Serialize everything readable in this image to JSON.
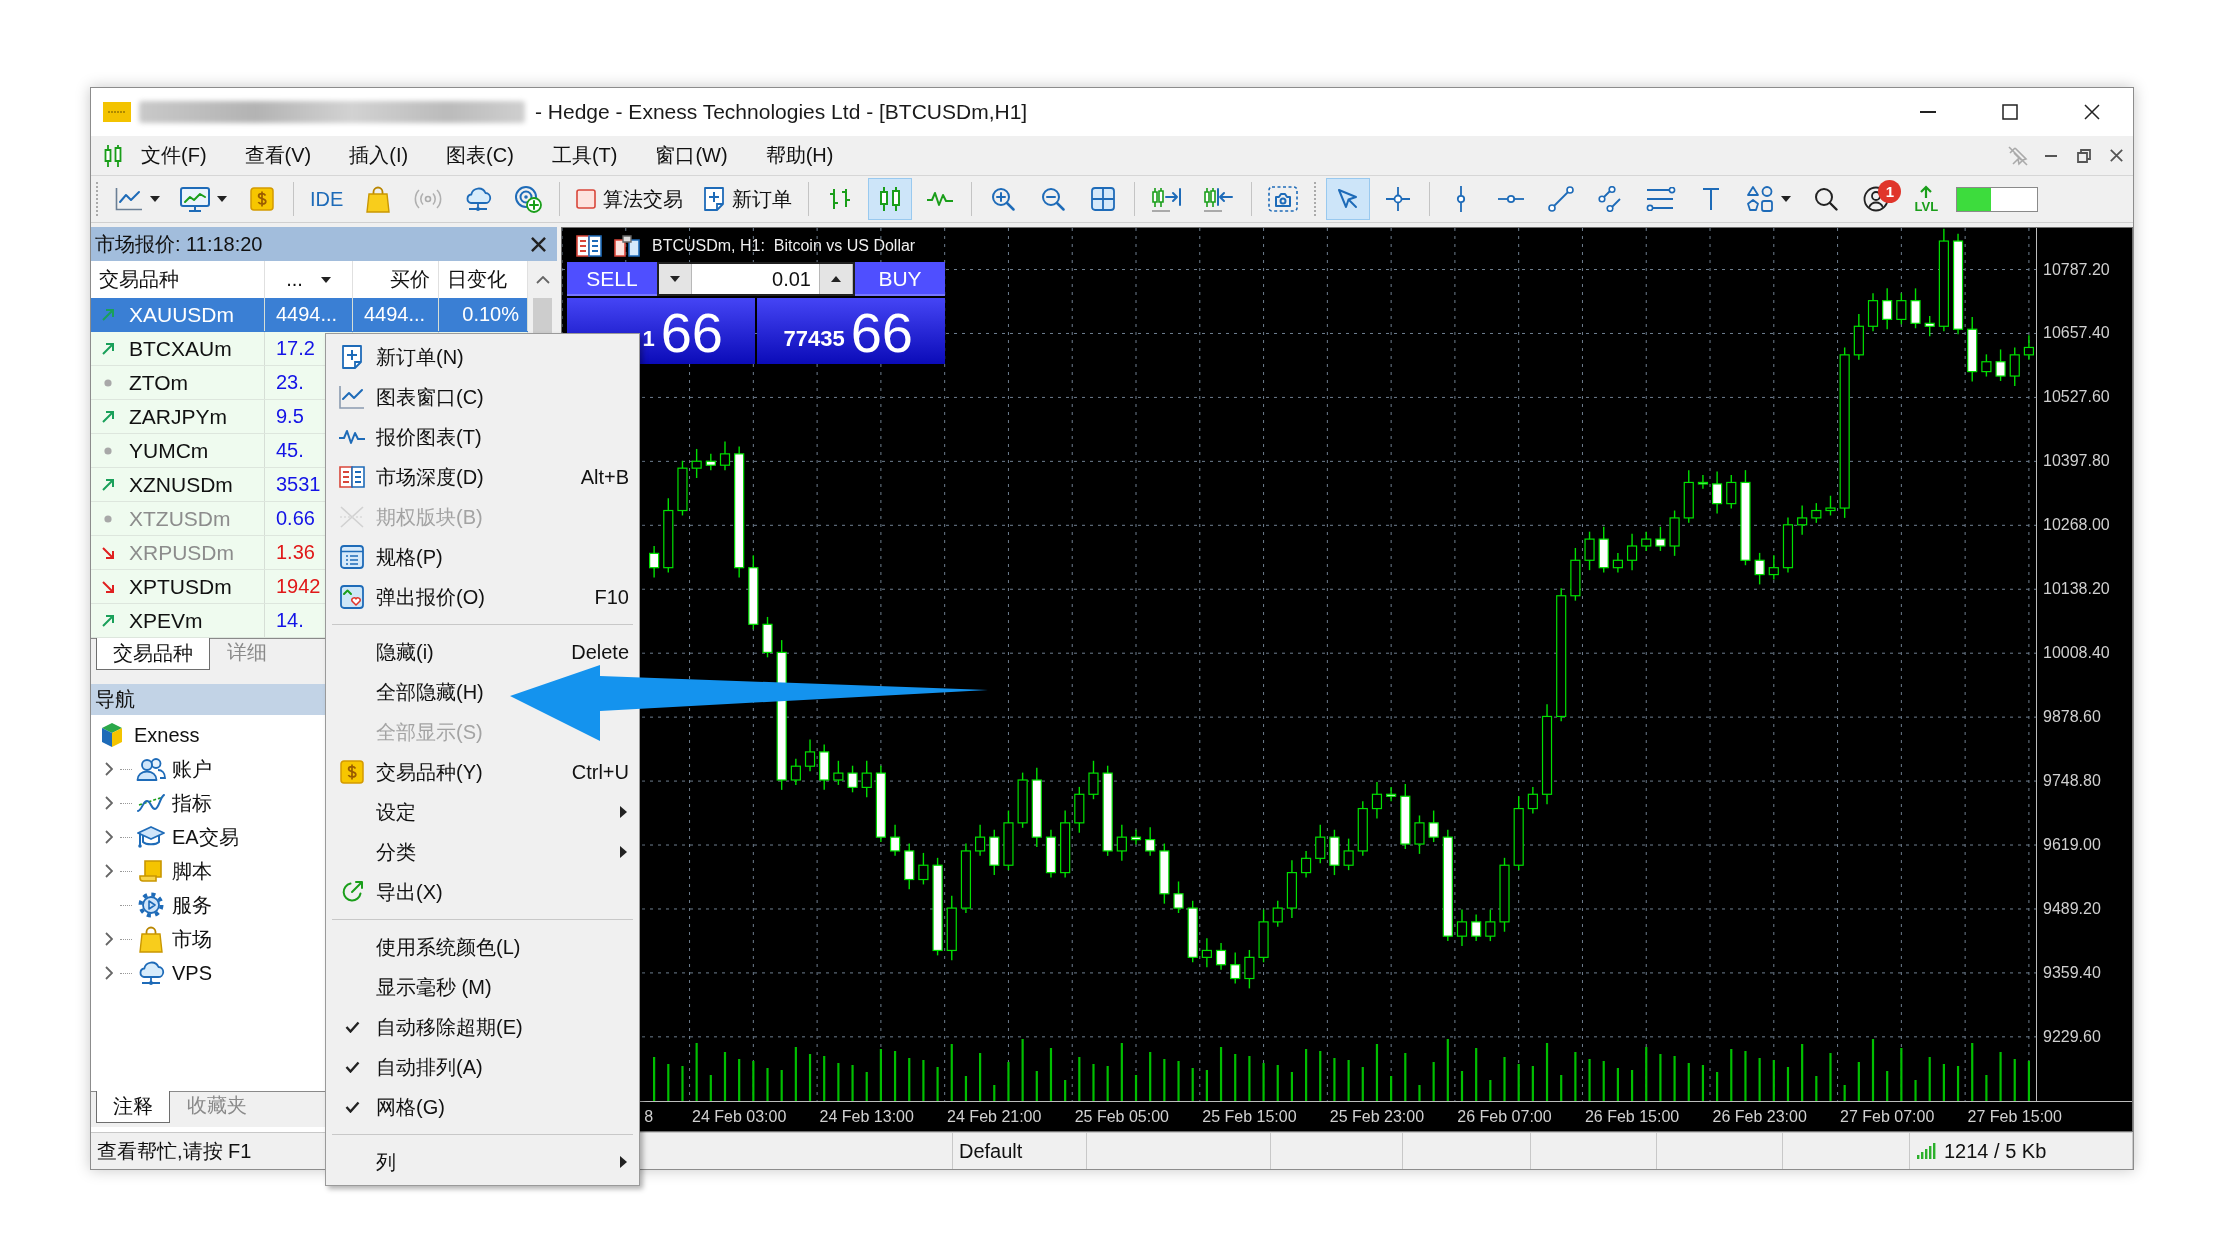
{
  "window": {
    "title": "- Hedge - Exness Technologies Ltd - [BTCUSDm,H1]"
  },
  "menu_bar": {
    "items": [
      "文件(F)",
      "查看(V)",
      "插入(I)",
      "图表(C)",
      "工具(T)",
      "窗口(W)",
      "帮助(H)"
    ]
  },
  "toolbar": {
    "ide_label": "IDE",
    "algo_trading_label": "算法交易",
    "new_order_label": "新订单",
    "chart_types": [
      {
        "selected": false
      },
      {
        "selected": true
      },
      {
        "selected": false
      }
    ],
    "cursor_modes": [
      {
        "selected": true
      },
      {
        "selected": false
      }
    ],
    "notification_badge": "1",
    "level_label": "LVL",
    "level_meter": {
      "level": 0.42
    }
  },
  "market_watch": {
    "title": "市场报价: 11:18:20",
    "columns": [
      "交易品种",
      "...",
      "买价",
      "日变化"
    ],
    "rows": [
      {
        "kind": "up",
        "dimmed": false,
        "selected": true,
        "cells": [
          "XAUUSDm",
          "4494...",
          "4494...",
          "0.10%"
        ]
      },
      {
        "kind": "up",
        "dimmed": false,
        "selected": false,
        "cells": [
          "BTCXAUm",
          "17.2"
        ]
      },
      {
        "kind": "none",
        "dimmed": false,
        "selected": false,
        "cells": [
          "ZTOm",
          "23."
        ]
      },
      {
        "kind": "up",
        "dimmed": false,
        "selected": false,
        "cells": [
          "ZARJPYm",
          "9.5"
        ]
      },
      {
        "kind": "none",
        "dimmed": false,
        "selected": false,
        "cells": [
          "YUMCm",
          "45."
        ]
      },
      {
        "kind": "up",
        "dimmed": false,
        "selected": false,
        "cells": [
          "XZNUSDm",
          "3531"
        ]
      },
      {
        "kind": "none",
        "dimmed": true,
        "selected": false,
        "cells": [
          "XTZUSDm",
          "0.66"
        ]
      },
      {
        "kind": "down",
        "dimmed": true,
        "selected": false,
        "cells": [
          "XRPUSDm",
          "1.36"
        ]
      },
      {
        "kind": "down",
        "dimmed": false,
        "selected": false,
        "cells": [
          "XPTUSDm",
          "1942"
        ]
      },
      {
        "kind": "up",
        "dimmed": false,
        "selected": false,
        "cells": [
          "XPEVm",
          "14."
        ]
      }
    ],
    "tabs": [
      {
        "label": "交易品种",
        "selected": true
      },
      {
        "label": "详细",
        "selected": false
      }
    ]
  },
  "navigator": {
    "title": "导航",
    "tree": [
      {
        "label": "Exness",
        "children": [
          {
            "label": "账户",
            "expanded": false
          },
          {
            "label": "指标",
            "expanded": false
          },
          {
            "label": "EA交易",
            "expanded": false
          },
          {
            "label": "脚本",
            "expanded": false
          },
          {
            "label": "服务"
          },
          {
            "label": "市场",
            "expanded": false
          },
          {
            "label": "VPS",
            "expanded": false
          }
        ]
      }
    ],
    "tabs": [
      {
        "label": "注释",
        "selected": true
      },
      {
        "label": "收藏夹",
        "selected": false
      }
    ]
  },
  "chart": {
    "title": "BTCUSDm, H1:  Bitcoin vs US Dollar",
    "trade_panel": {
      "sell_label": "SELL",
      "buy_label": "BUY",
      "volume": "0.01",
      "sell_price": {
        "prefix": "1",
        "main": "66"
      },
      "buy_price": {
        "prefix": "77435",
        "main": "66"
      }
    },
    "cut_time_label": "8",
    "chart_data": {
      "type": "candlestick",
      "grid": true,
      "categories": [
        null,
        null,
        null,
        null,
        null,
        null,
        null,
        null,
        null,
        null,
        null,
        null,
        "24 Feb 03:00",
        null,
        null,
        null,
        null,
        null,
        null,
        null,
        null,
        "24 Feb 13:00",
        null,
        null,
        null,
        null,
        null,
        null,
        null,
        null,
        "24 Feb 21:00",
        null,
        null,
        null,
        null,
        null,
        null,
        null,
        null,
        "25 Feb 05:00",
        null,
        null,
        null,
        null,
        null,
        null,
        null,
        null,
        "25 Feb 15:00",
        null,
        null,
        null,
        null,
        null,
        null,
        null,
        null,
        "25 Feb 23:00",
        null,
        null,
        null,
        null,
        null,
        null,
        null,
        null,
        "26 Feb 07:00",
        null,
        null,
        null,
        null,
        null,
        null,
        null,
        null,
        "26 Feb 15:00",
        null,
        null,
        null,
        null,
        null,
        null,
        null,
        null,
        "26 Feb 23:00",
        null,
        null,
        null,
        null,
        null,
        null,
        null,
        null,
        "27 Feb 07:00",
        null,
        null,
        null,
        null,
        null,
        null,
        null,
        null,
        "27 Feb 15:00",
        null
      ],
      "ohlc": [
        null,
        null,
        null,
        null,
        null,
        null,
        [
          10211,
          10226,
          10162,
          10182
        ],
        [
          10182,
          10323,
          10172,
          10298
        ],
        [
          10298,
          10399,
          10288,
          10384
        ],
        [
          10384,
          10423,
          10364,
          10398
        ],
        [
          10398,
          10413,
          10380,
          10390
        ],
        [
          10390,
          10438,
          10380,
          10413
        ],
        [
          10413,
          10428,
          10162,
          10182
        ],
        [
          10182,
          10207,
          10057,
          10067
        ],
        [
          10067,
          10082,
          10000,
          10010
        ],
        [
          10010,
          10035,
          9731,
          9751
        ],
        [
          9751,
          9794,
          9741,
          9779
        ],
        [
          9779,
          9833,
          9769,
          9808
        ],
        [
          9808,
          9823,
          9731,
          9751
        ],
        [
          9751,
          9790,
          9741,
          9765
        ],
        [
          9765,
          9780,
          9726,
          9736
        ],
        [
          9736,
          9790,
          9716,
          9765
        ],
        [
          9765,
          9780,
          9625,
          9635
        ],
        [
          9635,
          9660,
          9597,
          9607
        ],
        [
          9607,
          9622,
          9529,
          9549
        ],
        [
          9549,
          9603,
          9539,
          9578
        ],
        [
          9578,
          9593,
          9395,
          9405
        ],
        [
          9405,
          9516,
          9385,
          9491
        ],
        [
          9491,
          9622,
          9481,
          9607
        ],
        [
          9607,
          9660,
          9597,
          9635
        ],
        [
          9635,
          9650,
          9558,
          9578
        ],
        [
          9578,
          9689,
          9568,
          9664
        ],
        [
          9664,
          9766,
          9654,
          9751
        ],
        [
          9751,
          9776,
          9615,
          9635
        ],
        [
          9635,
          9650,
          9553,
          9563
        ],
        [
          9563,
          9689,
          9553,
          9664
        ],
        [
          9664,
          9737,
          9644,
          9722
        ],
        [
          9722,
          9790,
          9712,
          9765
        ],
        [
          9765,
          9780,
          9597,
          9607
        ],
        [
          9607,
          9660,
          9587,
          9635
        ],
        [
          9635,
          9650,
          9620,
          9630
        ],
        [
          9630,
          9655,
          9597,
          9607
        ],
        [
          9607,
          9622,
          9500,
          9520
        ],
        [
          9520,
          9545,
          9481,
          9491
        ],
        [
          9491,
          9506,
          9381,
          9391
        ],
        [
          9391,
          9430,
          9371,
          9405
        ],
        [
          9405,
          9420,
          9366,
          9376
        ],
        [
          9376,
          9401,
          9338,
          9348
        ],
        [
          9348,
          9406,
          9328,
          9391
        ],
        [
          9391,
          9488,
          9381,
          9463
        ],
        [
          9463,
          9506,
          9453,
          9491
        ],
        [
          9491,
          9588,
          9471,
          9563
        ],
        [
          9563,
          9607,
          9553,
          9592
        ],
        [
          9592,
          9660,
          9582,
          9635
        ],
        [
          9635,
          9650,
          9558,
          9578
        ],
        [
          9578,
          9632,
          9568,
          9607
        ],
        [
          9607,
          9708,
          9597,
          9693
        ],
        [
          9693,
          9747,
          9673,
          9722
        ],
        [
          9722,
          9737,
          9708,
          9718
        ],
        [
          9718,
          9743,
          9611,
          9621
        ],
        [
          9621,
          9679,
          9601,
          9664
        ],
        [
          9664,
          9689,
          9625,
          9635
        ],
        [
          9635,
          9650,
          9424,
          9434
        ],
        [
          9434,
          9488,
          9414,
          9463
        ],
        [
          9463,
          9478,
          9424,
          9434
        ],
        [
          9434,
          9488,
          9424,
          9463
        ],
        [
          9463,
          9593,
          9443,
          9578
        ],
        [
          9578,
          9718,
          9568,
          9693
        ],
        [
          9693,
          9737,
          9683,
          9722
        ],
        [
          9722,
          9905,
          9702,
          9880
        ],
        [
          9880,
          10140,
          9870,
          10125
        ],
        [
          10125,
          10222,
          10115,
          10197
        ],
        [
          10197,
          10255,
          10177,
          10240
        ],
        [
          10240,
          10265,
          10172,
          10182
        ],
        [
          10182,
          10212,
          10172,
          10197
        ],
        [
          10197,
          10251,
          10177,
          10226
        ],
        [
          10226,
          10255,
          10216,
          10240
        ],
        [
          10240,
          10265,
          10216,
          10226
        ],
        [
          10226,
          10298,
          10206,
          10283
        ],
        [
          10283,
          10380,
          10273,
          10355
        ],
        [
          10355,
          10370,
          10342,
          10352
        ],
        [
          10352,
          10377,
          10292,
          10312
        ],
        [
          10312,
          10370,
          10302,
          10355
        ],
        [
          10355,
          10380,
          10187,
          10197
        ],
        [
          10197,
          10212,
          10148,
          10168
        ],
        [
          10168,
          10207,
          10158,
          10182
        ],
        [
          10182,
          10284,
          10172,
          10269
        ],
        [
          10269,
          10308,
          10249,
          10283
        ],
        [
          10283,
          10313,
          10273,
          10298
        ],
        [
          10298,
          10328,
          10288,
          10303
        ],
        [
          10303,
          10629,
          10283,
          10614
        ],
        [
          10614,
          10697,
          10604,
          10672
        ],
        [
          10672,
          10739,
          10662,
          10724
        ],
        [
          10724,
          10749,
          10666,
          10686
        ],
        [
          10686,
          10739,
          10676,
          10724
        ],
        [
          10724,
          10749,
          10668,
          10678
        ],
        [
          10678,
          10693,
          10652,
          10672
        ],
        [
          10672,
          10870,
          10662,
          10845
        ],
        [
          10845,
          10860,
          10656,
          10666
        ],
        [
          10666,
          10691,
          10560,
          10580
        ],
        [
          10580,
          10615,
          10570,
          10600
        ],
        [
          10600,
          10625,
          10561,
          10571
        ],
        [
          10571,
          10629,
          10551,
          10614
        ],
        [
          10614,
          10654,
          10604,
          10629
        ]
      ],
      "ylim": [
        9099.4,
        10871.5
      ],
      "yticks": [
        {
          "value": 10787.2,
          "label": "10787.20"
        },
        {
          "value": 10657.4,
          "label": "10657.40"
        },
        {
          "value": 10527.6,
          "label": "10527.60"
        },
        {
          "value": 10397.8,
          "label": "10397.80"
        },
        {
          "value": 10268.0,
          "label": "10268.00"
        },
        {
          "value": 10138.2,
          "label": "10138.20"
        },
        {
          "value": 10008.4,
          "label": "10008.40"
        },
        {
          "value": 9878.6,
          "label": "9878.60"
        },
        {
          "value": 9748.8,
          "label": "9748.80"
        },
        {
          "value": 9619.0,
          "label": "9619.00"
        },
        {
          "value": 9489.2,
          "label": "9489.20"
        },
        {
          "value": 9359.4,
          "label": "9359.40"
        },
        {
          "value": 9229.6,
          "label": "9229.60"
        }
      ]
    }
  },
  "context_menu": {
    "items": [
      {
        "kind": "item",
        "label": "新订单(N)",
        "disabled": false,
        "checked": false,
        "submenu": false
      },
      {
        "kind": "item",
        "label": "图表窗口(C)",
        "disabled": false,
        "checked": false,
        "submenu": false
      },
      {
        "kind": "item",
        "label": "报价图表(T)",
        "disabled": false,
        "checked": false,
        "submenu": false
      },
      {
        "kind": "item",
        "label": "市场深度(D)",
        "shortcut": "Alt+B",
        "disabled": false,
        "checked": false,
        "submenu": false
      },
      {
        "kind": "item",
        "label": "期权版块(B)",
        "disabled": true,
        "checked": false,
        "submenu": false
      },
      {
        "kind": "item",
        "label": "规格(P)",
        "disabled": false,
        "checked": false,
        "submenu": false
      },
      {
        "kind": "item",
        "label": "弹出报价(O)",
        "shortcut": "F10",
        "disabled": false,
        "checked": false,
        "submenu": false
      },
      {
        "kind": "separator"
      },
      {
        "kind": "item",
        "label": "隐藏(i)",
        "shortcut": "Delete",
        "disabled": false,
        "checked": false,
        "submenu": false
      },
      {
        "kind": "item",
        "label": "全部隐藏(H)",
        "disabled": false,
        "checked": false,
        "submenu": false
      },
      {
        "kind": "item",
        "label": "全部显示(S)",
        "disabled": true,
        "checked": false,
        "submenu": false
      },
      {
        "kind": "item",
        "label": "交易品种(Y)",
        "shortcut": "Ctrl+U",
        "disabled": false,
        "checked": false,
        "submenu": false
      },
      {
        "kind": "item",
        "label": "设定",
        "disabled": false,
        "checked": false,
        "submenu": true
      },
      {
        "kind": "item",
        "label": "分类",
        "disabled": false,
        "checked": false,
        "submenu": true
      },
      {
        "kind": "item",
        "label": "导出(X)",
        "disabled": false,
        "checked": false,
        "submenu": false
      },
      {
        "kind": "separator"
      },
      {
        "kind": "item",
        "label": "使用系统颜色(L)",
        "disabled": false,
        "checked": false,
        "submenu": false
      },
      {
        "kind": "item",
        "label": "显示毫秒 (M)",
        "disabled": false,
        "checked": false,
        "submenu": false
      },
      {
        "kind": "item",
        "label": "自动移除超期(E)",
        "disabled": false,
        "checked": true,
        "submenu": false
      },
      {
        "kind": "item",
        "label": "自动排列(A)",
        "disabled": false,
        "checked": true,
        "submenu": false
      },
      {
        "kind": "item",
        "label": "网格(G)",
        "disabled": false,
        "checked": true,
        "submenu": false
      },
      {
        "kind": "separator"
      },
      {
        "kind": "item",
        "label": "列",
        "disabled": false,
        "checked": false,
        "submenu": true
      }
    ]
  },
  "status_bar": {
    "help": "查看帮忙,请按 F1",
    "profile": "Default",
    "traffic": "1214 / 5 Kb"
  }
}
